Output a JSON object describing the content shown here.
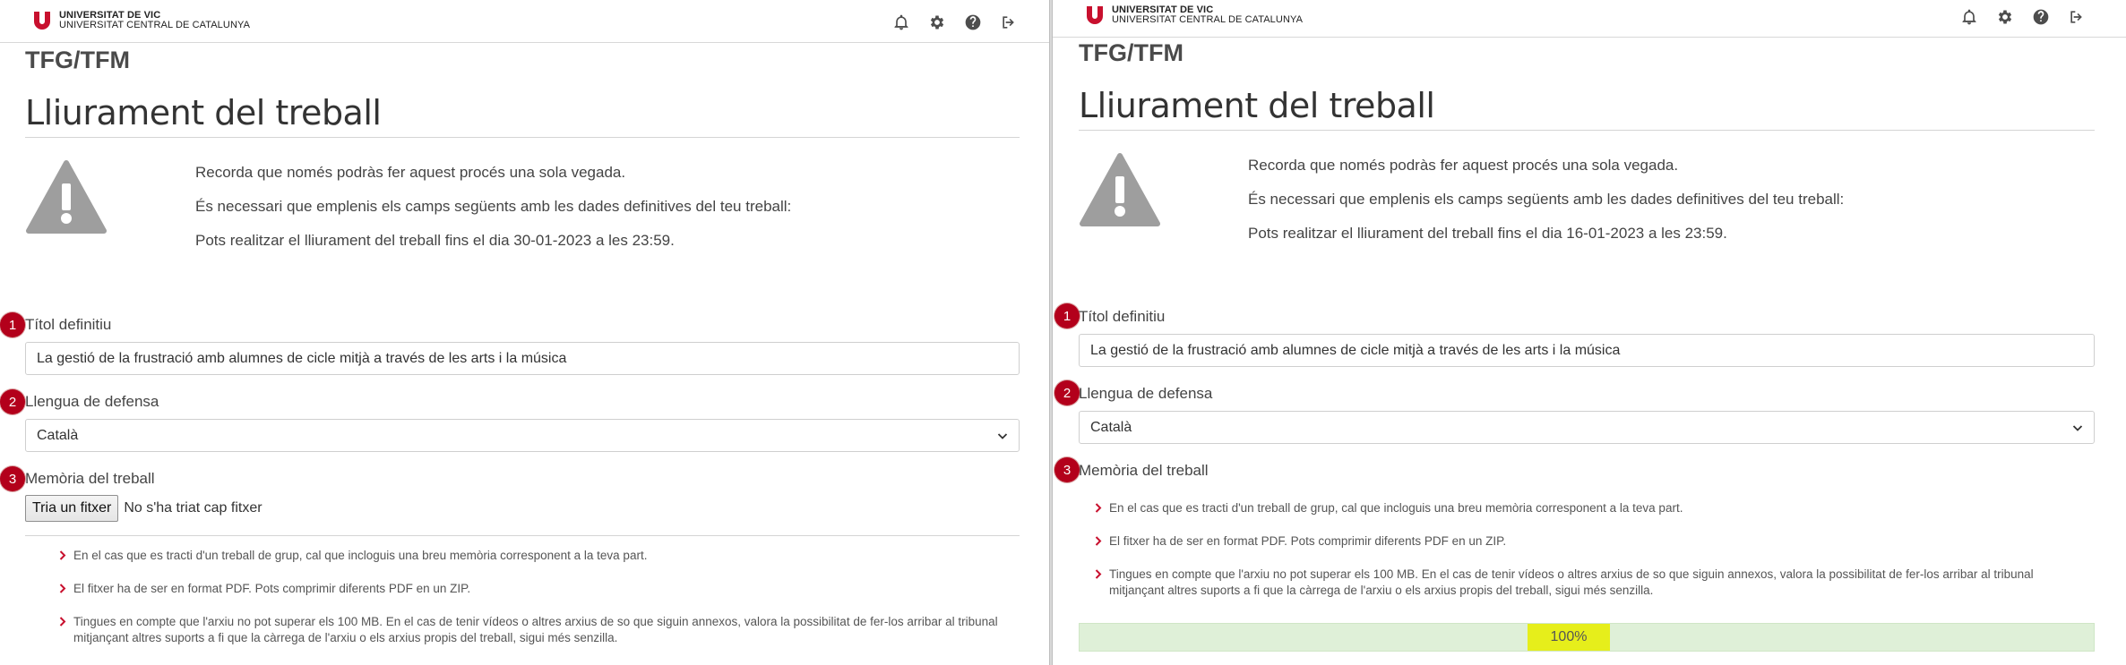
{
  "header": {
    "university_line1": "UNIVERSITAT DE VIC",
    "university_line2": "UNIVERSITAT CENTRAL DE CATALUNYA",
    "icons": [
      "bell-icon",
      "gear-icon",
      "help-icon",
      "logout-icon"
    ]
  },
  "colors": {
    "brand_red": "#b3001b",
    "progress_bg": "#dff0d8",
    "progress_fill": "#e6ee1b",
    "warning_gray": "#9e9e9e"
  },
  "left": {
    "section": "TFG/TFM",
    "title": "Lliurament del treball",
    "info": [
      "Recorda que només podràs fer aquest procés una sola vegada.",
      "És necessari que emplenis els camps següents amb les dades definitives del teu treball:",
      "Pots realitzar el lliurament del treball fins el dia 30-01-2023 a les 23:59."
    ],
    "steps": [
      "1",
      "2",
      "3"
    ],
    "title_label": "Títol definitiu",
    "title_value": "La gestió de la frustració amb alumnes de cicle mitjà a través de les arts i la música",
    "language_label": "Llengua de defensa",
    "language_value": "Català",
    "memory_label": "Memòria del treball",
    "file_button": "Tria un fitxer",
    "file_status": "No s'ha triat cap fitxer",
    "notes": [
      "En el cas que es tracti d'un treball de grup, cal que incloguis una breu memòria corresponent a la teva part.",
      "El fitxer ha de ser en format PDF. Pots comprimir diferents PDF en un ZIP.",
      "Tingues en compte que l'arxiu no pot superar els 100 MB. En el cas de tenir vídeos o altres arxius de so que siguin annexos, valora la possibilitat de fer-los arribar al tribunal mitjançant altres suports a fi que la càrrega de l'arxiu o els arxius propis del treball, sigui més senzilla."
    ]
  },
  "right": {
    "section": "TFG/TFM",
    "title": "Lliurament del treball",
    "info": [
      "Recorda que només podràs fer aquest procés una sola vegada.",
      "És necessari que emplenis els camps següents amb les dades definitives del teu treball:",
      "Pots realitzar el lliurament del treball fins el dia 16-01-2023 a les 23:59."
    ],
    "steps": [
      "1",
      "2",
      "3"
    ],
    "title_label": "Títol definitiu",
    "title_value": "La gestió de la frustració amb alumnes de cicle mitjà a través de les arts i la música",
    "language_label": "Llengua de defensa",
    "language_value": "Català",
    "memory_label": "Memòria del treball",
    "notes": [
      "En el cas que es tracti d'un treball de grup, cal que incloguis una breu memòria corresponent a la teva part.",
      "El fitxer ha de ser en format PDF. Pots comprimir diferents PDF en un ZIP.",
      "Tingues en compte que l'arxiu no pot superar els 100 MB. En el cas de tenir vídeos o altres arxius de so que siguin annexos, valora la possibilitat de fer-los arribar al tribunal mitjançant altres suports a fi que la càrrega de l'arxiu o els arxius propis del treball, sigui més senzilla."
    ],
    "progress_label": "100%",
    "progress_value": 100
  }
}
